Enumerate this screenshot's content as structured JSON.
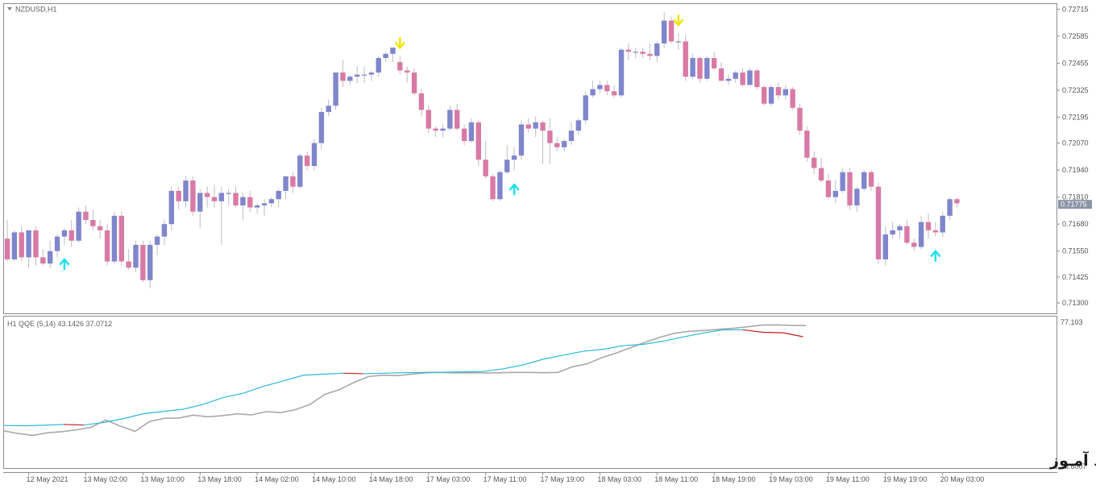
{
  "window": {
    "symbol_label": "NZDUSD,H1",
    "indicator_label": "H1  QQE (5,14) 43.1426 37.0712",
    "watermark": "انتشار در وبسایت سود آمـوز"
  },
  "colors": {
    "bull": "#7f86cc",
    "bear": "#d97aa6",
    "down_arrow": "#f2e600",
    "up_arrow": "#22e0ea",
    "qqe_fast": "#2bb7dd",
    "qqe_slow_bear": "#c31d1d",
    "qqe_slow_bull": "#a9a9a9",
    "price_marker": "#8a94a6"
  },
  "chart_data": [
    {
      "type": "candlestick",
      "symbol": "NZDUSD",
      "timeframe": "H1",
      "ylim": [
        0.7125,
        0.7274
      ],
      "y_ticks": [
        "0.72715",
        "0.72585",
        "0.72455",
        "0.72325",
        "0.72195",
        "0.72070",
        "0.71940",
        "0.71810",
        "0.71680",
        "0.71550",
        "0.71425",
        "0.71300"
      ],
      "last_price": "0.71775",
      "x_ticks": [
        {
          "index": 3,
          "label": "12 May 2021"
        },
        {
          "index": 11,
          "label": "13 May 02:00"
        },
        {
          "index": 19,
          "label": "13 May 10:00"
        },
        {
          "index": 27,
          "label": "13 May 18:00"
        },
        {
          "index": 35,
          "label": "14 May 02:00"
        },
        {
          "index": 43,
          "label": "14 May 10:00"
        },
        {
          "index": 51,
          "label": "14 May 18:00"
        },
        {
          "index": 59,
          "label": "17 May 03:00"
        },
        {
          "index": 67,
          "label": "17 May 11:00"
        },
        {
          "index": 75,
          "label": "17 May 19:00"
        },
        {
          "index": 83,
          "label": "18 May 03:00"
        },
        {
          "index": 91,
          "label": "18 May 11:00"
        },
        {
          "index": 99,
          "label": "18 May 19:00"
        },
        {
          "index": 107,
          "label": "19 May 03:00"
        },
        {
          "index": 115,
          "label": "19 May 11:00"
        },
        {
          "index": 123,
          "label": "19 May 19:00"
        },
        {
          "index": 131,
          "label": "20 May 03:00"
        }
      ],
      "candles": [
        [
          0.7161,
          0.717,
          0.715,
          0.7151
        ],
        [
          0.7151,
          0.7165,
          0.715,
          0.7164
        ],
        [
          0.7164,
          0.7167,
          0.715,
          0.7152
        ],
        [
          0.7152,
          0.7165,
          0.7147,
          0.7165
        ],
        [
          0.7165,
          0.7167,
          0.7148,
          0.7152
        ],
        [
          0.7152,
          0.7156,
          0.7148,
          0.7149
        ],
        [
          0.7149,
          0.716,
          0.7147,
          0.7155
        ],
        [
          0.7155,
          0.7163,
          0.7152,
          0.7162
        ],
        [
          0.7162,
          0.7166,
          0.7158,
          0.7165
        ],
        [
          0.7165,
          0.717,
          0.7157,
          0.716
        ],
        [
          0.716,
          0.7176,
          0.7159,
          0.7174
        ],
        [
          0.7174,
          0.7177,
          0.7168,
          0.717
        ],
        [
          0.717,
          0.7175,
          0.7165,
          0.7167
        ],
        [
          0.7167,
          0.717,
          0.7161,
          0.7165
        ],
        [
          0.7165,
          0.7168,
          0.7148,
          0.715
        ],
        [
          0.715,
          0.7174,
          0.7149,
          0.7172
        ],
        [
          0.7172,
          0.7174,
          0.7148,
          0.715
        ],
        [
          0.715,
          0.7156,
          0.7146,
          0.7147
        ],
        [
          0.7147,
          0.716,
          0.7145,
          0.7158
        ],
        [
          0.7158,
          0.716,
          0.714,
          0.7141
        ],
        [
          0.7141,
          0.716,
          0.7137,
          0.7158
        ],
        [
          0.7158,
          0.7163,
          0.7153,
          0.7162
        ],
        [
          0.7162,
          0.717,
          0.7158,
          0.7168
        ],
        [
          0.7168,
          0.7186,
          0.7165,
          0.7184
        ],
        [
          0.7184,
          0.7186,
          0.7175,
          0.7179
        ],
        [
          0.7179,
          0.7191,
          0.7176,
          0.7189
        ],
        [
          0.7189,
          0.7191,
          0.7172,
          0.7174
        ],
        [
          0.7174,
          0.7185,
          0.7166,
          0.7183
        ],
        [
          0.7183,
          0.7186,
          0.7176,
          0.7181
        ],
        [
          0.7181,
          0.7187,
          0.7176,
          0.7179
        ],
        [
          0.7179,
          0.7186,
          0.7158,
          0.7183
        ],
        [
          0.7183,
          0.7185,
          0.7177,
          0.7183
        ],
        [
          0.7183,
          0.7186,
          0.7176,
          0.7177
        ],
        [
          0.7177,
          0.7183,
          0.717,
          0.7181
        ],
        [
          0.7181,
          0.7184,
          0.7174,
          0.7176
        ],
        [
          0.7176,
          0.7178,
          0.7173,
          0.7177
        ],
        [
          0.7177,
          0.718,
          0.7172,
          0.7178
        ],
        [
          0.7178,
          0.7181,
          0.7176,
          0.718
        ],
        [
          0.718,
          0.7185,
          0.7176,
          0.7184
        ],
        [
          0.7184,
          0.7191,
          0.718,
          0.7191
        ],
        [
          0.7191,
          0.7193,
          0.7183,
          0.7186
        ],
        [
          0.7186,
          0.7202,
          0.7185,
          0.7201
        ],
        [
          0.7201,
          0.7203,
          0.7194,
          0.7196
        ],
        [
          0.7196,
          0.7209,
          0.7194,
          0.7207
        ],
        [
          0.7207,
          0.7224,
          0.7204,
          0.7222
        ],
        [
          0.7222,
          0.7228,
          0.722,
          0.7225
        ],
        [
          0.7225,
          0.724,
          0.7223,
          0.7241
        ],
        [
          0.7241,
          0.7247,
          0.7234,
          0.7237
        ],
        [
          0.7237,
          0.724,
          0.7235,
          0.7239
        ],
        [
          0.7239,
          0.7244,
          0.7236,
          0.724
        ],
        [
          0.724,
          0.7244,
          0.7236,
          0.724
        ],
        [
          0.724,
          0.7242,
          0.7237,
          0.7241
        ],
        [
          0.7241,
          0.7249,
          0.7239,
          0.7248
        ],
        [
          0.7248,
          0.7251,
          0.7246,
          0.725
        ],
        [
          0.725,
          0.7253,
          0.7246,
          0.7253
        ],
        [
          0.7246,
          0.7249,
          0.724,
          0.7242
        ],
        [
          0.7242,
          0.7244,
          0.7236,
          0.7241
        ],
        [
          0.7241,
          0.7243,
          0.723,
          0.7231
        ],
        [
          0.7231,
          0.7233,
          0.722,
          0.7223
        ],
        [
          0.7223,
          0.7225,
          0.7212,
          0.7214
        ],
        [
          0.7214,
          0.7215,
          0.721,
          0.7213
        ],
        [
          0.7213,
          0.7216,
          0.721,
          0.7214
        ],
        [
          0.7214,
          0.7225,
          0.7213,
          0.7223
        ],
        [
          0.7223,
          0.7226,
          0.7213,
          0.7214
        ],
        [
          0.7214,
          0.7216,
          0.7206,
          0.7208
        ],
        [
          0.7208,
          0.7219,
          0.7207,
          0.7217
        ],
        [
          0.7217,
          0.7218,
          0.7196,
          0.7199
        ],
        [
          0.7199,
          0.7208,
          0.719,
          0.7191
        ],
        [
          0.7191,
          0.7192,
          0.7179,
          0.718
        ],
        [
          0.718,
          0.7194,
          0.7179,
          0.7193
        ],
        [
          0.7193,
          0.7206,
          0.7192,
          0.7199
        ],
        [
          0.7199,
          0.7205,
          0.7194,
          0.7201
        ],
        [
          0.7201,
          0.7218,
          0.7199,
          0.7216
        ],
        [
          0.7216,
          0.7219,
          0.7212,
          0.7214
        ],
        [
          0.7214,
          0.722,
          0.721,
          0.7217
        ],
        [
          0.7217,
          0.7218,
          0.7197,
          0.7213
        ],
        [
          0.7213,
          0.7219,
          0.7197,
          0.7207
        ],
        [
          0.7207,
          0.721,
          0.7203,
          0.7205
        ],
        [
          0.7205,
          0.7209,
          0.7203,
          0.7208
        ],
        [
          0.7208,
          0.7217,
          0.7206,
          0.7213
        ],
        [
          0.7213,
          0.7219,
          0.7211,
          0.7218
        ],
        [
          0.7218,
          0.7232,
          0.7216,
          0.723
        ],
        [
          0.723,
          0.7237,
          0.7229,
          0.7233
        ],
        [
          0.7233,
          0.7237,
          0.7231,
          0.7235
        ],
        [
          0.7235,
          0.7237,
          0.723,
          0.7232
        ],
        [
          0.7232,
          0.7235,
          0.7229,
          0.723
        ],
        [
          0.723,
          0.7253,
          0.7229,
          0.7252
        ],
        [
          0.7252,
          0.7255,
          0.7247,
          0.7251
        ],
        [
          0.7251,
          0.7253,
          0.7248,
          0.7251
        ],
        [
          0.7251,
          0.7253,
          0.7248,
          0.725
        ],
        [
          0.725,
          0.7255,
          0.7247,
          0.7249
        ],
        [
          0.7249,
          0.7256,
          0.7246,
          0.7255
        ],
        [
          0.7255,
          0.727,
          0.7253,
          0.7266
        ],
        [
          0.7266,
          0.7268,
          0.7255,
          0.7256
        ],
        [
          0.7256,
          0.726,
          0.7252,
          0.7256
        ],
        [
          0.7256,
          0.7259,
          0.7237,
          0.7239
        ],
        [
          0.7239,
          0.725,
          0.7238,
          0.7248
        ],
        [
          0.7248,
          0.7249,
          0.7236,
          0.7238
        ],
        [
          0.7238,
          0.7249,
          0.7237,
          0.7248
        ],
        [
          0.7248,
          0.7251,
          0.7242,
          0.7243
        ],
        [
          0.7243,
          0.7246,
          0.7237,
          0.7237
        ],
        [
          0.7237,
          0.724,
          0.7235,
          0.7238
        ],
        [
          0.7238,
          0.7242,
          0.7236,
          0.7241
        ],
        [
          0.7241,
          0.7243,
          0.7234,
          0.7235
        ],
        [
          0.7235,
          0.7243,
          0.7235,
          0.7242
        ],
        [
          0.7242,
          0.7243,
          0.7233,
          0.7234
        ],
        [
          0.7234,
          0.7235,
          0.7225,
          0.7226
        ],
        [
          0.7226,
          0.7235,
          0.7225,
          0.7234
        ],
        [
          0.7234,
          0.7236,
          0.7228,
          0.723
        ],
        [
          0.723,
          0.7235,
          0.7228,
          0.7233
        ],
        [
          0.7233,
          0.7234,
          0.7223,
          0.7224
        ],
        [
          0.7224,
          0.7226,
          0.7211,
          0.7213
        ],
        [
          0.7213,
          0.7215,
          0.7198,
          0.72
        ],
        [
          0.72,
          0.7203,
          0.7192,
          0.7195
        ],
        [
          0.7195,
          0.72,
          0.7188,
          0.7189
        ],
        [
          0.7189,
          0.7192,
          0.718,
          0.7181
        ],
        [
          0.7181,
          0.7189,
          0.7178,
          0.7184
        ],
        [
          0.7184,
          0.7195,
          0.7183,
          0.7193
        ],
        [
          0.7193,
          0.7195,
          0.7175,
          0.7177
        ],
        [
          0.7177,
          0.7186,
          0.7174,
          0.7185
        ],
        [
          0.7185,
          0.7194,
          0.7184,
          0.7193
        ],
        [
          0.7193,
          0.7194,
          0.7184,
          0.7186
        ],
        [
          0.7186,
          0.7188,
          0.7149,
          0.7151
        ],
        [
          0.7151,
          0.7167,
          0.7148,
          0.7163
        ],
        [
          0.7163,
          0.7169,
          0.7161,
          0.7165
        ],
        [
          0.7165,
          0.7168,
          0.7161,
          0.7167
        ],
        [
          0.7167,
          0.717,
          0.7158,
          0.7159
        ],
        [
          0.7159,
          0.7161,
          0.7155,
          0.7157
        ],
        [
          0.7157,
          0.7172,
          0.7156,
          0.7169
        ],
        [
          0.7169,
          0.7173,
          0.7161,
          0.7165
        ],
        [
          0.7165,
          0.7169,
          0.7162,
          0.7164
        ],
        [
          0.7164,
          0.7174,
          0.7162,
          0.7172
        ],
        [
          0.7172,
          0.7181,
          0.717,
          0.718
        ],
        [
          0.718,
          0.7181,
          0.7176,
          0.7178
        ]
      ],
      "signals": [
        {
          "index": 8,
          "type": "up"
        },
        {
          "index": 55,
          "type": "down"
        },
        {
          "index": 71,
          "type": "up"
        },
        {
          "index": 94,
          "type": "down"
        },
        {
          "index": 130,
          "type": "up"
        }
      ]
    },
    {
      "type": "line",
      "indicator": "QQE (5,14)",
      "ylim": [
        18.6007,
        77.103
      ],
      "y_ticks": [
        "77.103",
        "18.6007"
      ],
      "series": [
        {
          "values": [
            32.7,
            31.6,
            30.9,
            31.9,
            32.4,
            33.1,
            34.2,
            37.1,
            34.6,
            32.5,
            36.5,
            37.8,
            37.9,
            39.1,
            38.4,
            38.9,
            39.6,
            39.2,
            40.5,
            40.1,
            41.3,
            43.4,
            47.5,
            49.4,
            52.3,
            54.7,
            55.3,
            55.1,
            55.7,
            56.3,
            56.4,
            56.2,
            56.3,
            56.2,
            56.3,
            56.4,
            56.4,
            56.3,
            56.4,
            58.7,
            59.9,
            62.4,
            64.3,
            66.5,
            68.7,
            70.7,
            72.3,
            73.1,
            73.4,
            73.9,
            74.3,
            74.9,
            75.6,
            75.7,
            75.5,
            75.4
          ]
        },
        {
          "values": [
            37.5,
            37.4,
            37.6,
            37.9,
            37.7,
            38.7,
            40.3,
            42.3,
            43.2,
            44.1,
            46.1,
            48.9,
            50.6,
            53.4,
            55.6,
            57.9,
            58.3,
            58.7,
            58.5,
            58.7,
            58.9,
            59.0,
            59.1,
            59.3,
            59.4,
            60.5,
            62.1,
            64.4,
            66.0,
            67.6,
            68.4,
            69.9,
            70.4,
            71.7,
            73.4,
            75.0,
            76.3,
            76.3,
            75.3,
            75.1,
            73.5
          ]
        }
      ]
    }
  ]
}
